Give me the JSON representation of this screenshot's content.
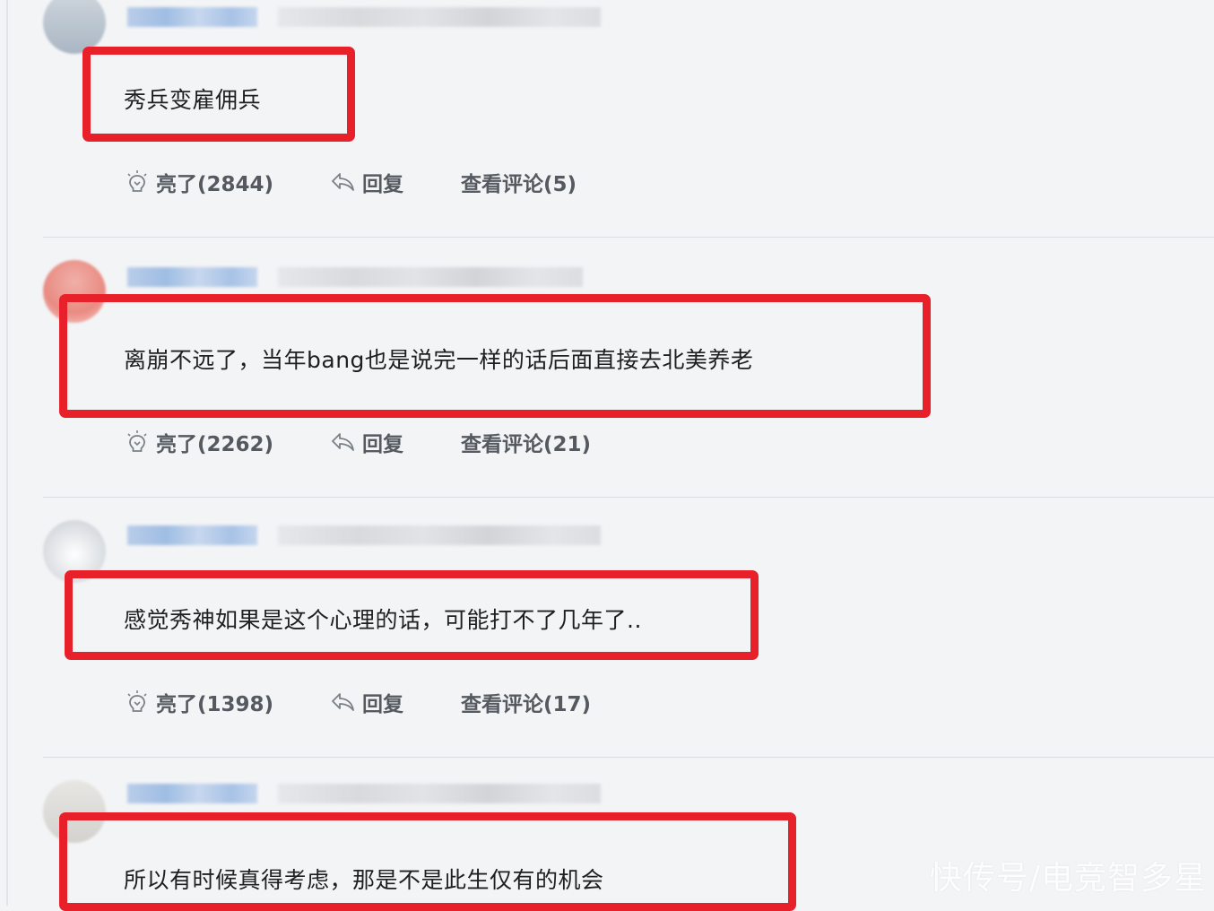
{
  "comments": [
    {
      "text": "秀兵变雇佣兵",
      "likes": "亮了(2844)",
      "reply": "回复",
      "view": "查看评论(5)"
    },
    {
      "text": "离崩不远了，当年bang也是说完一样的话后面直接去北美养老",
      "likes": "亮了(2262)",
      "reply": "回复",
      "view": "查看评论(21)"
    },
    {
      "text": "感觉秀神如果是这个心理的话，可能打不了几年了..",
      "likes": "亮了(1398)",
      "reply": "回复",
      "view": "查看评论(17)"
    },
    {
      "text": "所以有时候真得考虑，那是不是此生仅有的机会"
    }
  ],
  "watermark": "快传号/电竞智多星",
  "colors": {
    "highlight": "#e8202a",
    "background": "#f3f4f6",
    "action_text": "#555a61"
  },
  "icons": {
    "like": "lightbulb-icon",
    "reply": "reply-arrow-icon"
  }
}
